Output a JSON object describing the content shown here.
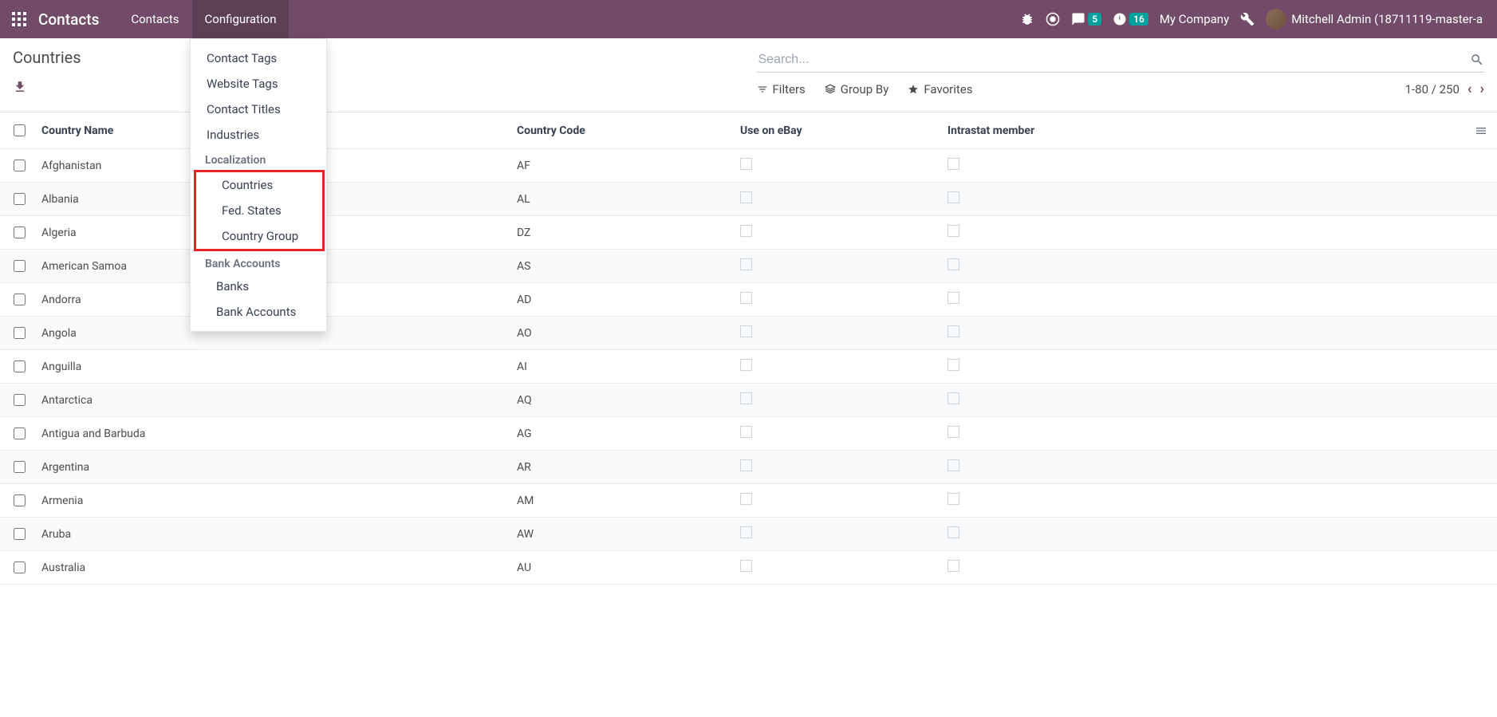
{
  "navbar": {
    "brand": "Contacts",
    "menu": [
      {
        "label": "Contacts"
      },
      {
        "label": "Configuration"
      }
    ],
    "messages_badge": "5",
    "activities_badge": "16",
    "company": "My Company",
    "username": "Mitchell Admin (18711119-master-a"
  },
  "breadcrumb": {
    "title": "Countries"
  },
  "search": {
    "placeholder": "Search...",
    "filters": "Filters",
    "group_by": "Group By",
    "favorites": "Favorites",
    "pager": "1-80 / 250"
  },
  "dropdown": {
    "items_top": [
      "Contact Tags",
      "Website Tags",
      "Contact Titles",
      "Industries"
    ],
    "section_localization": "Localization",
    "items_localization": [
      "Countries",
      "Fed. States",
      "Country Group"
    ],
    "section_bank": "Bank Accounts",
    "items_bank": [
      "Banks",
      "Bank Accounts"
    ]
  },
  "table": {
    "headers": {
      "name": "Country Name",
      "code": "Country Code",
      "ebay": "Use on eBay",
      "intrastat": "Intrastat member"
    },
    "rows": [
      {
        "name": "Afghanistan",
        "code": "AF"
      },
      {
        "name": "Albania",
        "code": "AL"
      },
      {
        "name": "Algeria",
        "code": "DZ"
      },
      {
        "name": "American Samoa",
        "code": "AS"
      },
      {
        "name": "Andorra",
        "code": "AD"
      },
      {
        "name": "Angola",
        "code": "AO"
      },
      {
        "name": "Anguilla",
        "code": "AI"
      },
      {
        "name": "Antarctica",
        "code": "AQ"
      },
      {
        "name": "Antigua and Barbuda",
        "code": "AG"
      },
      {
        "name": "Argentina",
        "code": "AR"
      },
      {
        "name": "Armenia",
        "code": "AM"
      },
      {
        "name": "Aruba",
        "code": "AW"
      },
      {
        "name": "Australia",
        "code": "AU"
      }
    ]
  }
}
